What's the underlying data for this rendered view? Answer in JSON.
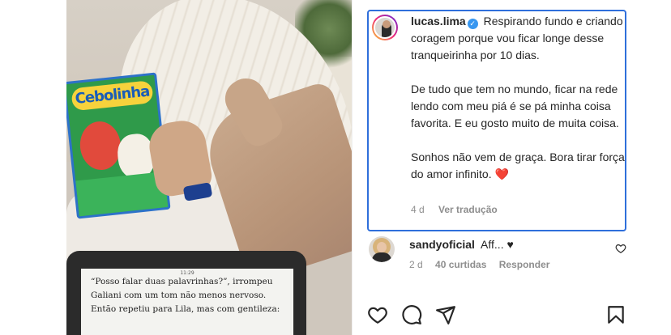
{
  "post": {
    "author": "lucas.lima",
    "caption": {
      "first": "Respirando fundo e criando coragem porque vou ficar longe desse tranqueirinha por 10 dias.",
      "second": "De tudo que tem no mundo, ficar na rede lendo com meu piá é se pá minha coisa favorita. E eu gosto muito de muita coisa.",
      "third": "Sonhos não vem de graça. Bora tirar força do amor infinito.",
      "emoji": "❤️"
    },
    "age": "4 d",
    "see_translation": "Ver tradução"
  },
  "comment": {
    "author": "sandyoficial",
    "text": "Aff...",
    "emoji": "♥",
    "age": "2 d",
    "likes": "40 curtidas",
    "reply": "Responder"
  },
  "media": {
    "comic_title": "Cebolinha",
    "ereader_time": "11:29",
    "ereader_lines": [
      "“Posso falar duas palavrinhas?”, irrompeu",
      "Galiani com um tom não menos nervoso.",
      "Então repetiu para Lila, mas com gentileza:"
    ]
  },
  "colors": {
    "highlight_border": "#2f6fdb",
    "verified": "#3897f0",
    "secondary_text": "#8e8e8e"
  },
  "icons": [
    "verified-badge-icon",
    "heart-icon",
    "comment-icon",
    "share-icon",
    "bookmark-icon",
    "like-comment-icon"
  ]
}
